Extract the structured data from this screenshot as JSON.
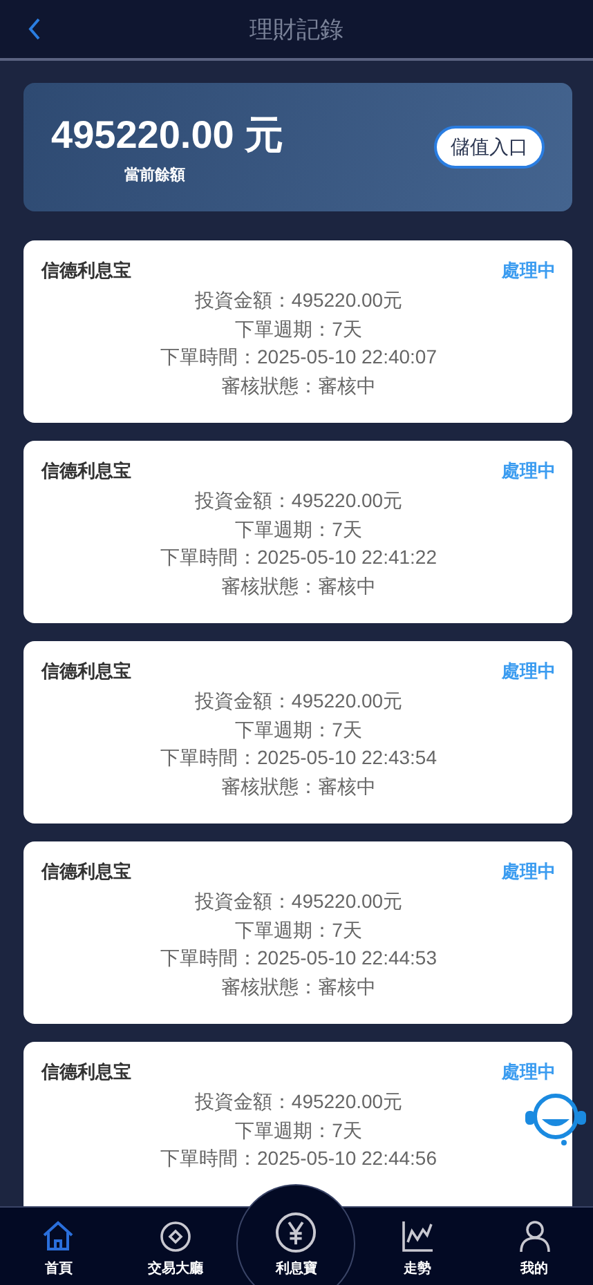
{
  "header": {
    "title": "理財記錄"
  },
  "balance": {
    "amount": "495220.00 元",
    "label": "當前餘額",
    "button": "儲值入口"
  },
  "records": [
    {
      "name": "信德利息宝",
      "status": "處理中",
      "lines": [
        "投資金額：495220.00元",
        "下單週期：7天",
        "下單時間：2025-05-10 22:40:07",
        "審核狀態：審核中"
      ]
    },
    {
      "name": "信德利息宝",
      "status": "處理中",
      "lines": [
        "投資金額：495220.00元",
        "下單週期：7天",
        "下單時間：2025-05-10 22:41:22",
        "審核狀態：審核中"
      ]
    },
    {
      "name": "信德利息宝",
      "status": "處理中",
      "lines": [
        "投資金額：495220.00元",
        "下單週期：7天",
        "下單時間：2025-05-10 22:43:54",
        "審核狀態：審核中"
      ]
    },
    {
      "name": "信德利息宝",
      "status": "處理中",
      "lines": [
        "投資金額：495220.00元",
        "下單週期：7天",
        "下單時間：2025-05-10 22:44:53",
        "審核狀態：審核中"
      ]
    },
    {
      "name": "信德利息宝",
      "status": "處理中",
      "lines": [
        "投資金額：495220.00元",
        "下單週期：7天",
        "下單時間：2025-05-10 22:44:56"
      ]
    }
  ],
  "nav": [
    {
      "label": "首頁",
      "selected": true
    },
    {
      "label": "交易大廳",
      "selected": false
    },
    {
      "label": "利息寶",
      "kind": "center",
      "selected": false
    },
    {
      "label": "走勢",
      "selected": false
    },
    {
      "label": "我的",
      "selected": false
    }
  ]
}
